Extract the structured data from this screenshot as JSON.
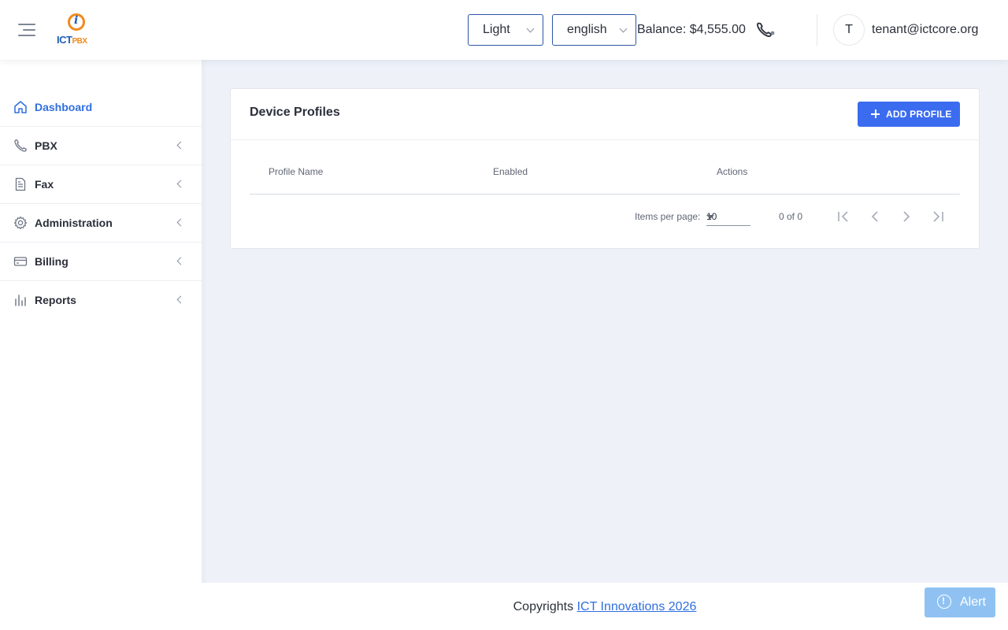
{
  "header": {
    "theme_value": "Light",
    "language_value": "english",
    "balance": "Balance: $4,555.00",
    "avatar_initial": "T",
    "user_email": "tenant@ictcore.org",
    "logo_text_main": "ICT",
    "logo_text_sub": "PBX"
  },
  "sidebar": {
    "items": [
      {
        "label": "Dashboard",
        "icon": "home-icon",
        "active": true
      },
      {
        "label": "PBX",
        "icon": "phone-icon"
      },
      {
        "label": "Fax",
        "icon": "document-icon"
      },
      {
        "label": "Administration",
        "icon": "gear-icon"
      },
      {
        "label": "Billing",
        "icon": "credit-card-icon"
      },
      {
        "label": "Reports",
        "icon": "bar-chart-icon"
      }
    ]
  },
  "card": {
    "title": "Device Profiles",
    "add_button": "ADD PROFILE",
    "columns": [
      "Profile Name",
      "Enabled",
      "Actions"
    ],
    "rows": [],
    "pagination": {
      "items_per_page_label": "Items per page:",
      "items_per_page_value": "10",
      "range": "0 of 0"
    }
  },
  "footer": {
    "text": "Copyrights",
    "link": "ICT Innovations 2026"
  },
  "alert_button": "Alert",
  "colors": {
    "accent": "#3b6cf0",
    "active_nav": "#2f6fe0",
    "background": "#eef1f8",
    "alert": "#8fc2f2"
  }
}
